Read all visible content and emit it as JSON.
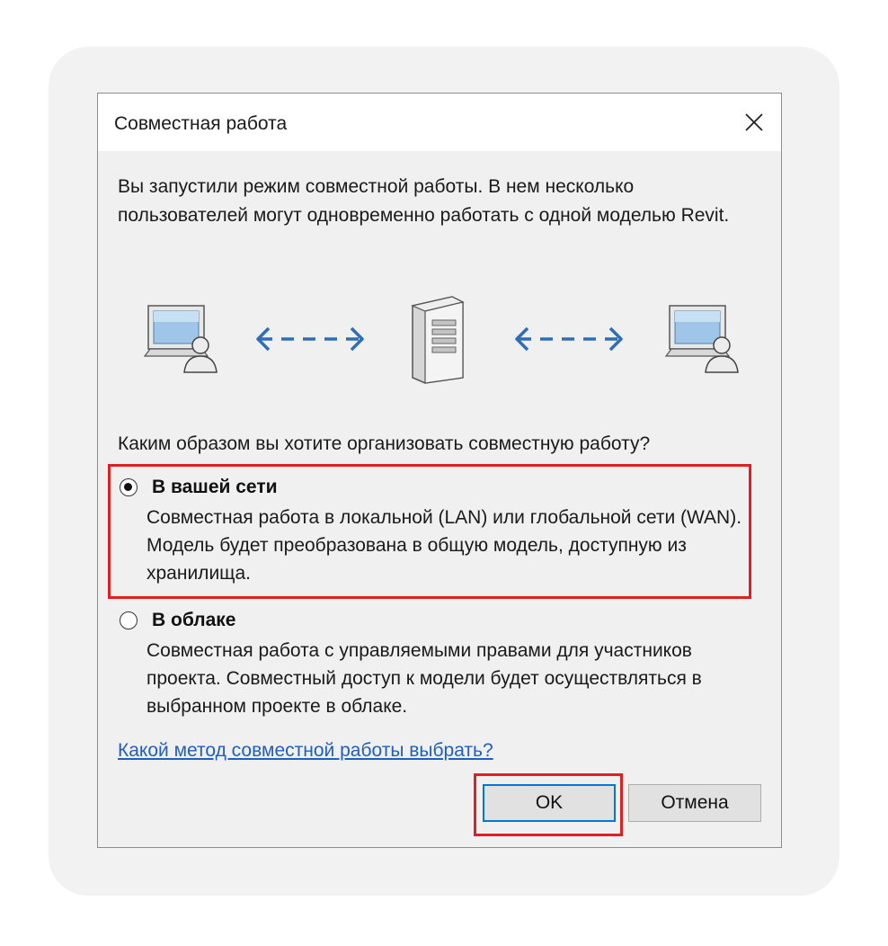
{
  "dialog": {
    "title": "Совместная работа",
    "intro": "Вы запустили режим совместной работы. В нем несколько пользователей могут одновременно работать с одной моделью Revit.",
    "question": "Каким образом вы хотите организовать совместную работу?",
    "options": [
      {
        "label": "В вашей сети",
        "description": "Совместная работа в локальной (LAN) или глобальной сети (WAN). Модель будет преобразована в общую модель, доступную из хранилища.",
        "selected": true
      },
      {
        "label": "В облаке",
        "description": "Совместная работа с управляемыми правами для участников проекта. Совместный доступ к модели будет осуществляться в выбранном проекте в облаке.",
        "selected": false
      }
    ],
    "help_link": "Какой метод совместной работы выбрать?",
    "ok_label": "OK",
    "cancel_label": "Отмена"
  },
  "icons": [
    "close-icon",
    "workstation-user-icon",
    "bidirectional-arrow-icon",
    "server-icon"
  ],
  "colors": {
    "highlight": "#e02020",
    "link": "#1f5fbf",
    "arrow": "#2f6db5",
    "focus": "#0078d7"
  }
}
